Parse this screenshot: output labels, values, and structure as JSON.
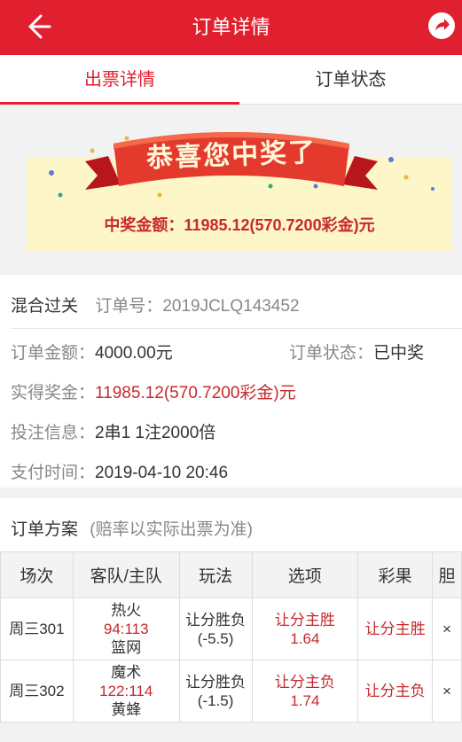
{
  "header": {
    "title": "订单详情"
  },
  "tabs": [
    {
      "label": "出票详情",
      "active": true
    },
    {
      "label": "订单状态",
      "active": false
    }
  ],
  "banner": {
    "headline": "恭喜您中奖了",
    "prize_label": "中奖金额：",
    "prize_value": "11985.12(570.7200彩金)元"
  },
  "order": {
    "play_type": "混合过关",
    "order_no_label": "订单号：",
    "order_no": "2019JCLQ143452",
    "amount_label": "订单金额：",
    "amount": "4000.00元",
    "status_label": "订单状态：",
    "status": "已中奖",
    "bonus_label": "实得奖金：",
    "bonus": "11985.12(570.7200彩金)元",
    "bet_label": "投注信息：",
    "bet": "2串1 1注2000倍",
    "pay_time_label": "支付时间：",
    "pay_time": "2019-04-10 20:46"
  },
  "plan": {
    "title": "订单方案",
    "note": "(赔率以实际出票为准)",
    "columns": [
      "场次",
      "客队/主队",
      "玩法",
      "选项",
      "彩果",
      "胆"
    ],
    "rows": [
      {
        "match": "周三301",
        "away": "热火",
        "score": "94:113",
        "home": "篮网",
        "play": "让分胜负",
        "handicap": "(-5.5)",
        "option": "让分主胜",
        "odds": "1.64",
        "result": "让分主胜",
        "banker": "×"
      },
      {
        "match": "周三302",
        "away": "魔术",
        "score": "122:114",
        "home": "黄蜂",
        "play": "让分胜负",
        "handicap": "(-1.5)",
        "option": "让分主负",
        "odds": "1.74",
        "result": "让分主负",
        "banker": "×"
      }
    ]
  },
  "colors": {
    "brand": "#e0202f",
    "highlight": "#c8282c",
    "banner_bg": "#fdf6c8"
  }
}
